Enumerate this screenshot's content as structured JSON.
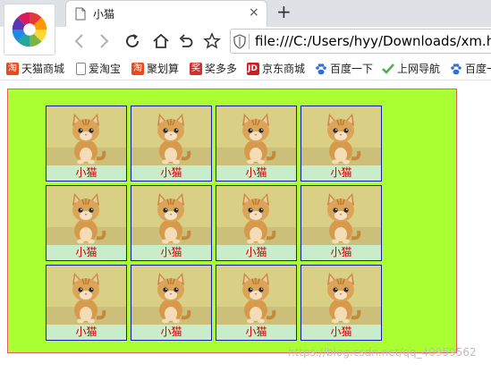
{
  "browser": {
    "tab": {
      "title": "小猫",
      "close_symbol": "×"
    },
    "new_tab_symbol": "+",
    "address": {
      "url": "file:///C:/Users/hyy/Downloads/xm.ht"
    },
    "icons": [
      "browser-logo-icon",
      "back-icon",
      "forward-icon",
      "reload-icon",
      "home-icon",
      "undo-icon",
      "star-icon",
      "shield-icon",
      "document-icon"
    ]
  },
  "bookmarks": [
    {
      "label": "天猫商城",
      "icon": "taobao-icon",
      "color": "#e8491d"
    },
    {
      "label": "爱淘宝",
      "icon": "document-icon",
      "color": "#888888"
    },
    {
      "label": "聚划算",
      "icon": "taobao-icon",
      "color": "#e8491d"
    },
    {
      "label": "奖多多",
      "icon": "prize-icon",
      "color": "#d32f2f"
    },
    {
      "label": "京东商城",
      "icon": "jd-icon",
      "color": "#d71920"
    },
    {
      "label": "百度一下",
      "icon": "baidu-paw-icon",
      "color": "#2f6fd8"
    },
    {
      "label": "上网导航",
      "icon": "hao-check-icon",
      "color": "#4caf50"
    },
    {
      "label": "百度一",
      "icon": "baidu-paw-icon",
      "color": "#2f6fd8"
    }
  ],
  "page": {
    "background_color": "#aaff33",
    "border_color": "#e06060",
    "card_border_color": "#1a1aa8",
    "label_color": "#cc0000",
    "label_bg": "#c9eccb",
    "grid": {
      "rows": 3,
      "columns": 4
    },
    "cards": [
      {
        "label": "小猫"
      },
      {
        "label": "小猫"
      },
      {
        "label": "小猫"
      },
      {
        "label": "小猫"
      },
      {
        "label": "小猫"
      },
      {
        "label": "小猫"
      },
      {
        "label": "小猫"
      },
      {
        "label": "小猫"
      },
      {
        "label": "小猫"
      },
      {
        "label": "小猫"
      },
      {
        "label": "小猫"
      },
      {
        "label": "小猫"
      }
    ]
  },
  "watermark": "https://blog.csdn.net/qq_40959562"
}
